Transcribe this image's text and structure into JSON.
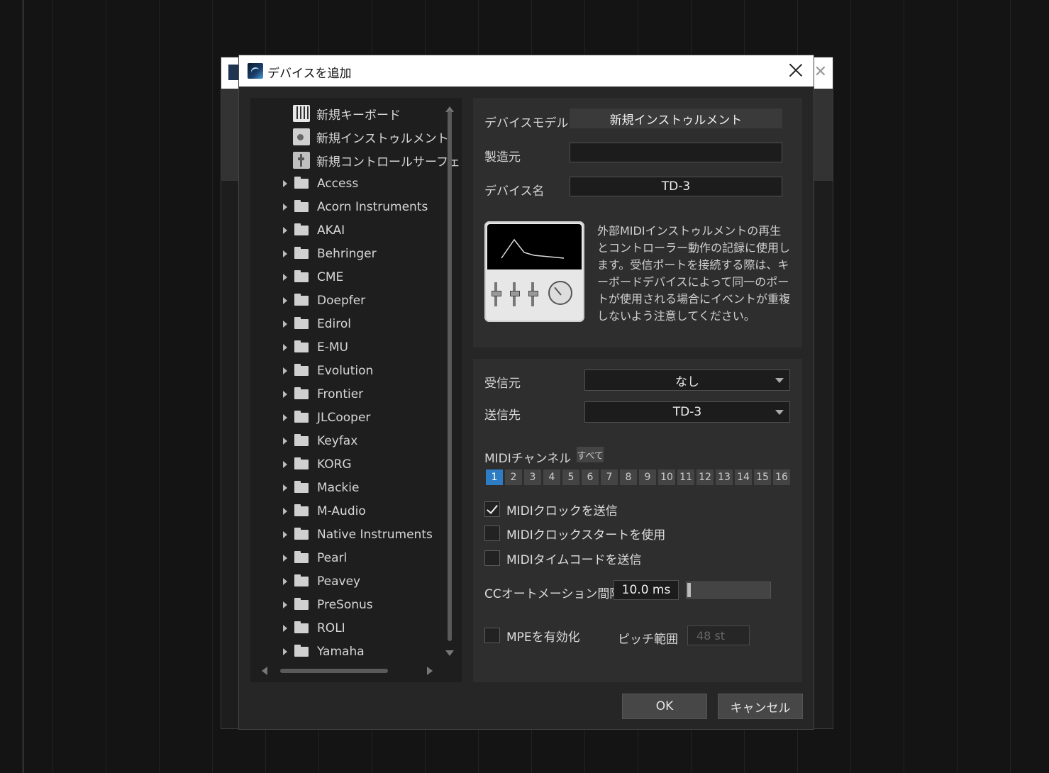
{
  "dialog": {
    "title": "デバイスを追加",
    "ok_label": "OK",
    "cancel_label": "キャンセル"
  },
  "tree": {
    "new_items": [
      {
        "label": "新規キーボード",
        "icon": "keyboard-icon"
      },
      {
        "label": "新規インストゥルメント",
        "icon": "instrument-icon"
      },
      {
        "label": "新規コントロールサーフェス",
        "icon": "control-surface-icon"
      }
    ],
    "folders": [
      "Access",
      "Acorn Instruments",
      "AKAI",
      "Behringer",
      "CME",
      "Doepfer",
      "Edirol",
      "E-MU",
      "Evolution",
      "Frontier",
      "JLCooper",
      "Keyfax",
      "KORG",
      "Mackie",
      "M-Audio",
      "Native Instruments",
      "Pearl",
      "Peavey",
      "PreSonus",
      "ROLI",
      "Yamaha"
    ]
  },
  "device": {
    "model_label": "デバイスモデル",
    "model_value": "新規インストゥルメント",
    "maker_label": "製造元",
    "maker_value": "",
    "name_label": "デバイス名",
    "name_value": "TD-3",
    "description": "外部MIDIインストゥルメントの再生とコントローラー動作の記録に使用します。受信ポートを接続する際は、キーボードデバイスによって同一のポートが使用される場合にイベントが重複しないよう注意してください。"
  },
  "io": {
    "receive_label": "受信元",
    "receive_value": "なし",
    "send_label": "送信先",
    "send_value": "TD-3",
    "midi_channel_label": "MIDIチャンネル",
    "all_label": "すべて",
    "channels": [
      "1",
      "2",
      "3",
      "4",
      "5",
      "6",
      "7",
      "8",
      "9",
      "10",
      "11",
      "12",
      "13",
      "14",
      "15",
      "16"
    ],
    "active_channel": "1",
    "midi_clock_label": "MIDIクロックを送信",
    "midi_clock_checked": true,
    "midi_clock_start_label": "MIDIクロックスタートを使用",
    "midi_clock_start_checked": false,
    "midi_timecode_label": "MIDIタイムコードを送信",
    "midi_timecode_checked": false,
    "cc_label": "CCオートメーション間隔",
    "cc_value": "10.0 ms",
    "cc_slider_fraction": 0.0,
    "mpe_label": "MPEを有効化",
    "mpe_checked": false,
    "pitch_label": "ピッチ範囲",
    "pitch_value": "48 st"
  },
  "colors": {
    "accent": "#2e7cc4",
    "panel": "#2e2e2e",
    "background": "#141414"
  }
}
